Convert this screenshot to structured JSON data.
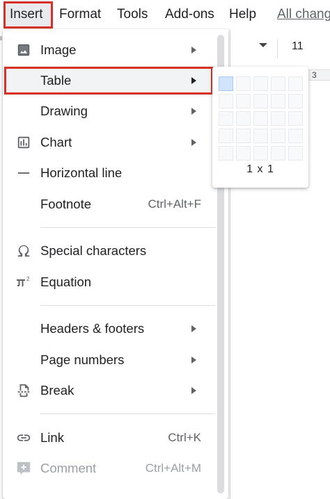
{
  "menubar": {
    "items": [
      "Insert",
      "Format",
      "Tools",
      "Add-ons",
      "Help"
    ],
    "all_changes": "All chang"
  },
  "toolbar": {
    "font_size": "11",
    "ruler_number": "3"
  },
  "menu": {
    "items": [
      {
        "label": "Image",
        "icon": "image-icon",
        "submenu": true
      },
      {
        "label": "Table",
        "icon": "",
        "submenu": true,
        "highlighted": true
      },
      {
        "label": "Drawing",
        "icon": "",
        "submenu": true
      },
      {
        "label": "Chart",
        "icon": "chart-icon",
        "submenu": true
      },
      {
        "label": "Horizontal line",
        "icon": "horizontal-line-icon"
      },
      {
        "label": "Footnote",
        "shortcut": "Ctrl+Alt+F"
      },
      {
        "label": "Special characters",
        "icon": "omega-icon"
      },
      {
        "label": "Equation",
        "icon": "pi-squared-icon"
      },
      {
        "label": "Headers & footers",
        "submenu": true
      },
      {
        "label": "Page numbers",
        "submenu": true
      },
      {
        "label": "Break",
        "icon": "page-break-icon",
        "submenu": true
      },
      {
        "label": "Link",
        "icon": "link-icon",
        "shortcut": "Ctrl+K"
      },
      {
        "label": "Comment",
        "icon": "add-comment-icon",
        "shortcut": "Ctrl+Alt+M",
        "disabled": true
      }
    ]
  },
  "table_submenu": {
    "grid_columns": 5,
    "grid_rows": 5,
    "selected": "1 x 1"
  },
  "colors": {
    "highlight_box": "#d93025",
    "hover_bg": "#f1f3f4",
    "selected_cell": "#d2e3fc"
  }
}
